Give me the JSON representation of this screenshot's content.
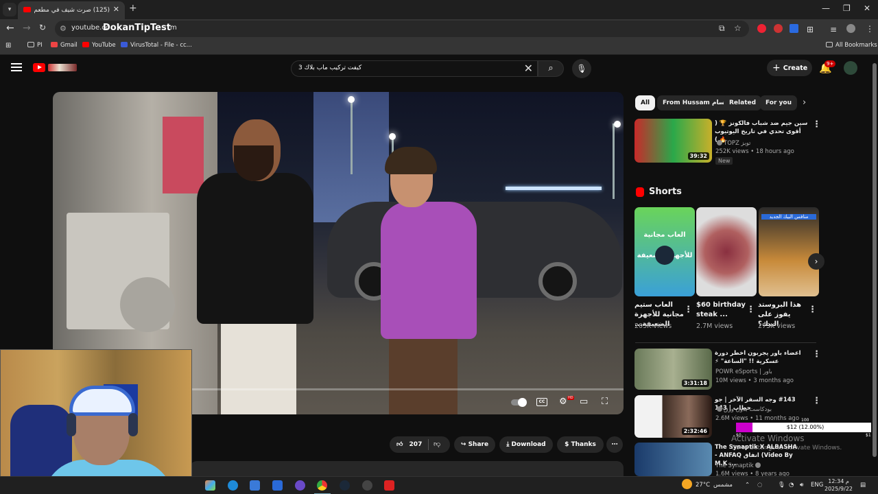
{
  "browser": {
    "tab_title": "(125) صرت شيف في مطعم",
    "url": "youtube.co",
    "url_overlay": "DokanTipTest",
    "url_tail": "m",
    "bookmarks": [
      "PI",
      "Gmail",
      "YouTube",
      "VirusTotal - File - cc...",
      "All Bookmarks"
    ]
  },
  "youtube": {
    "search_query": "كيفت تركيب ماب بلاك 3",
    "create_label": "Create",
    "notif_count": "9+"
  },
  "video": {
    "progress": 0.0,
    "actions": {
      "likes": "207",
      "share": "Share",
      "download": "Download",
      "thanks": "Thanks"
    }
  },
  "sidebar": {
    "chips": [
      "All",
      "From Hussam حسام",
      "Related",
      "For you"
    ],
    "top_video": {
      "title": "سين جيم ضد شباب فالكونز 🏆 ( أقوى تحدي في تاريخ اليوتيوب 🔥 )",
      "channel": "TOPZ توبز",
      "meta": "252K views • 18 hours ago",
      "badge": "New",
      "duration": "39:32"
    },
    "shorts_header": "Shorts",
    "shorts": [
      {
        "title": "العاب ستيم مجانية للأجهزة الضعيفة...",
        "views": "203K views",
        "thumb_text": "العاب مجانية للأجهزة الضعيفة"
      },
      {
        "title": "$60 birthday steak ...",
        "views": "2.7M views"
      },
      {
        "title": "هذا البروستد يفوز على البيك؟",
        "views": "275K views",
        "thumb_text": "منافس البيك الجديد"
      }
    ],
    "videos": [
      {
        "title": "اعضاء باور يجربون اخطر دورة عسكرية !! \"الساعة\" ⚡",
        "channel": "POWR eSports | باور",
        "meta": "10M views • 3 months ago",
        "duration": "3:31:18"
      },
      {
        "title": "#143 وجه السفر الآخر | جو حطاب | 143",
        "channel": "بودكاست بدون ورق",
        "meta": "2.6M views • 11 months ago",
        "duration": "2:32:46"
      },
      {
        "title": "The Synaptik X ALBASHA - ANFAQ انفاق (Video By M.K ...",
        "channel": "The Synaptik",
        "meta": "1.6M views • 8 years ago"
      }
    ]
  },
  "overlay": {
    "bar_label": "$12 (12.00%)",
    "bar_fraction": 0.12,
    "max_label": "100",
    "min_label": "$0",
    "right_label": "$100",
    "activate_title": "Activate Windows",
    "activate_sub": "Go to Settings to activate Windows."
  },
  "taskbar": {
    "weather": "27°C",
    "weather_text": "مشمس",
    "lang": "ENG",
    "time": "12:34 م",
    "date": "2025/9/22"
  }
}
